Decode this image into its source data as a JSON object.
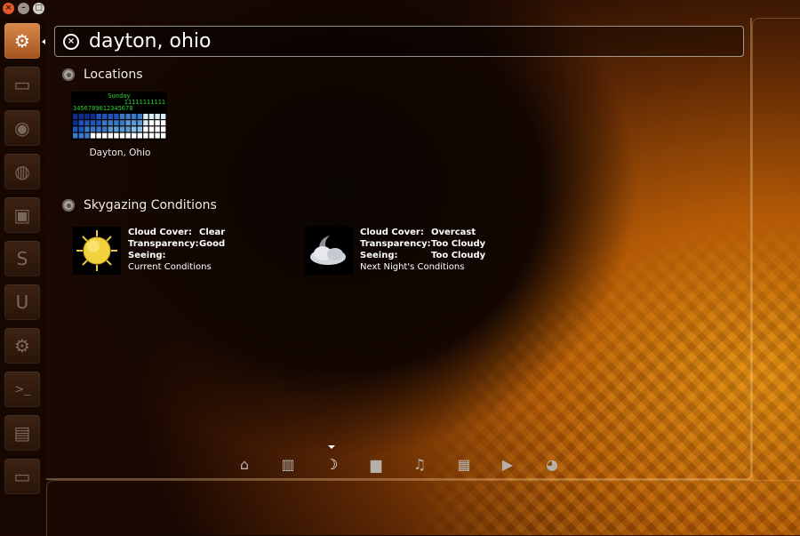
{
  "window": {
    "close_glyph": "×",
    "min_glyph": "–",
    "max_glyph": "□"
  },
  "launcher": {
    "items": [
      {
        "name": "dash-home-icon",
        "glyph": "⚙"
      },
      {
        "name": "files-icon",
        "glyph": "▭"
      },
      {
        "name": "media-icon",
        "glyph": "◉"
      },
      {
        "name": "firefox-icon",
        "glyph": "◍"
      },
      {
        "name": "software-center-icon",
        "glyph": "▣"
      },
      {
        "name": "skype-icon",
        "glyph": "S"
      },
      {
        "name": "ubuntu-one-icon",
        "glyph": "U"
      },
      {
        "name": "system-settings-icon",
        "glyph": "⚙"
      },
      {
        "name": "terminal-icon",
        "glyph": ">_"
      },
      {
        "name": "workspace-switcher-icon",
        "glyph": "▤"
      },
      {
        "name": "trash-icon",
        "glyph": "▭"
      }
    ]
  },
  "search": {
    "value": "dayton, ohio",
    "clear_glyph": "×"
  },
  "sections": {
    "locations": {
      "title": "Locations"
    },
    "skygazing": {
      "title": "Skygazing Conditions"
    }
  },
  "location_result": {
    "label": "Dayton, Ohio",
    "chart_day": "Sunday",
    "chart_tens": "11111111111",
    "chart_hours": "3456789012345678"
  },
  "skygazing": {
    "current": {
      "cloud_cover_label": "Cloud Cover:",
      "cloud_cover": "Clear",
      "transparency_label": "Transparency:",
      "transparency": "Good",
      "seeing_label": "Seeing:",
      "seeing": "",
      "caption": "Current Conditions",
      "icon": "sun-icon"
    },
    "next": {
      "cloud_cover_label": "Cloud Cover:",
      "cloud_cover": "Overcast",
      "transparency_label": "Transparency:",
      "transparency": "Too Cloudy",
      "seeing_label": "Seeing:",
      "seeing": "Too Cloudy",
      "caption": "Next Night's Conditions",
      "icon": "cloudy-moon-icon"
    }
  },
  "lenses": [
    {
      "name": "home-lens-icon",
      "glyph": "⌂"
    },
    {
      "name": "applications-lens-icon",
      "glyph": "▥"
    },
    {
      "name": "astronomy-lens-icon",
      "glyph": "☽"
    },
    {
      "name": "files-lens-icon",
      "glyph": "▆"
    },
    {
      "name": "music-lens-icon",
      "glyph": "♫"
    },
    {
      "name": "news-lens-icon",
      "glyph": "▦"
    },
    {
      "name": "video-lens-icon",
      "glyph": "▶"
    },
    {
      "name": "social-lens-icon",
      "glyph": "◕"
    }
  ],
  "active_lens": 2
}
